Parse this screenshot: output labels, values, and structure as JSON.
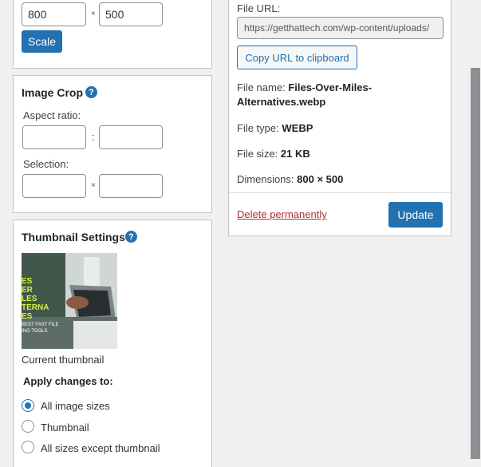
{
  "scale": {
    "width_value": "800",
    "height_value": "500",
    "times": "×",
    "button_label": "Scale"
  },
  "crop": {
    "heading": "Image Crop",
    "help": "?",
    "aspect_label": "Aspect ratio:",
    "aspect_sep": ":",
    "selection_label": "Selection:",
    "times": "×"
  },
  "thumbnail": {
    "heading": "Thumbnail Settings",
    "help": "?",
    "image_text_lines": [
      "ES",
      "ER",
      "LES",
      "TERNA",
      "ES"
    ],
    "image_subtext": [
      "BEST FAST FILE",
      "ING TOOLS"
    ],
    "caption": "Current thumbnail",
    "apply_label": "Apply changes to:",
    "options": [
      {
        "label": "All image sizes",
        "checked": true
      },
      {
        "label": "Thumbnail",
        "checked": false
      },
      {
        "label": "All sizes except thumbnail",
        "checked": false
      }
    ]
  },
  "details": {
    "url_label": "File URL:",
    "url_value": "https://getthattech.com/wp-content/uploads/",
    "copy_button": "Copy URL to clipboard",
    "file_name_label": "File name:",
    "file_name_value": "Files-Over-Miles-Alternatives.webp",
    "file_type_label": "File type:",
    "file_type_value": "WEBP",
    "file_size_label": "File size:",
    "file_size_value": "21 KB",
    "dimensions_label": "Dimensions:",
    "dimensions_value": "800 × 500",
    "delete_link": "Delete permanently",
    "update_button": "Update"
  },
  "colors": {
    "primary": "#2271b1",
    "danger": "#b32d2e",
    "background": "#f0f0f1"
  }
}
